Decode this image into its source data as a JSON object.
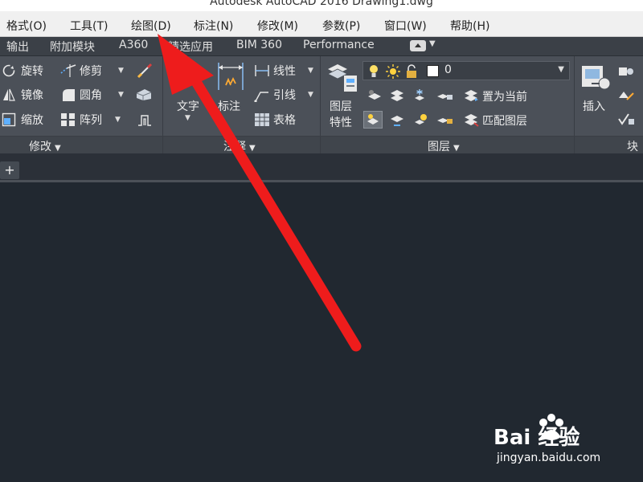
{
  "window": {
    "title": "Autodesk AutoCAD 2016    Drawing1.dwg"
  },
  "menu": {
    "items": [
      "格式(O)",
      "工具(T)",
      "绘图(D)",
      "标注(N)",
      "修改(M)",
      "参数(P)",
      "窗口(W)",
      "帮助(H)"
    ]
  },
  "ribbon_tabs": {
    "items": [
      "输出",
      "附加模块",
      "A360",
      "精选应用",
      "BIM 360",
      "Performance"
    ]
  },
  "modify_panel": {
    "title": "修改",
    "rotate": "旋转",
    "trim": "修剪",
    "mirror": "镜像",
    "fillet": "圆角",
    "scale": "缩放",
    "array": "阵列"
  },
  "annotation_panel": {
    "title": "注释",
    "text": "文字",
    "dimension": "标注",
    "linear": "线性",
    "leader": "引线",
    "table": "表格"
  },
  "layers_panel": {
    "title": "图层",
    "layer_properties": "图层\n特性",
    "layer_properties_l1": "图层",
    "layer_properties_l2": "特性",
    "current_layer": "0",
    "set_current": "置为当前",
    "match_layer": "匹配图层"
  },
  "block_panel": {
    "title": "块",
    "insert": "插入"
  },
  "file_tabs": {
    "new_tab_symbol": "+"
  },
  "watermark": {
    "brand": "Bai 经验",
    "url": "jingyan.baidu.com"
  },
  "colors": {
    "annotation_arrow": "#ee1c1c",
    "ribbon_bg": "#4b5058",
    "canvas_bg": "#212830"
  }
}
